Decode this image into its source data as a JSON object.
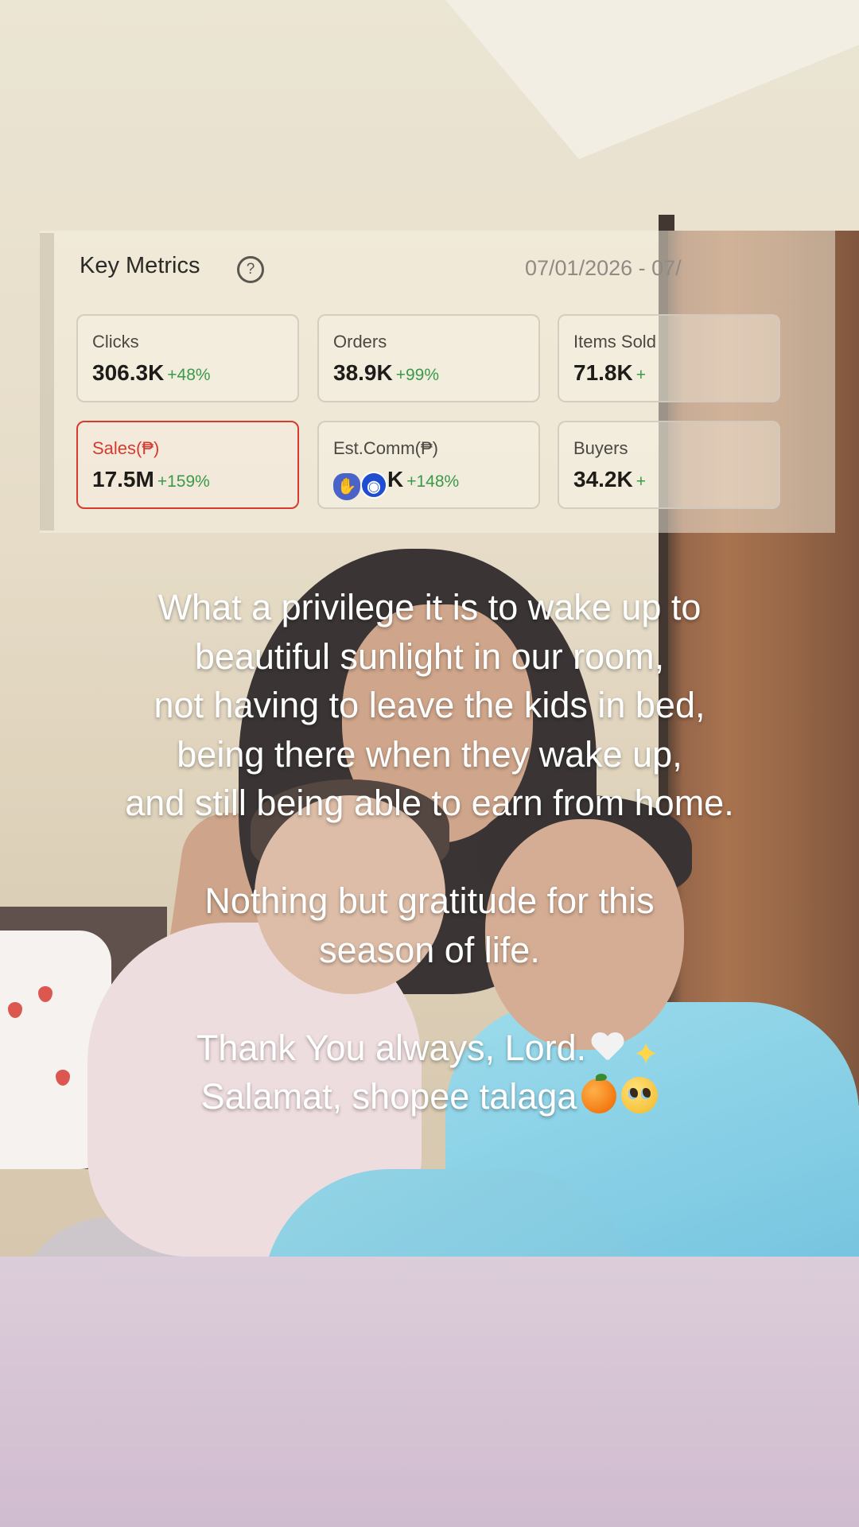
{
  "dashboard": {
    "title": "Key Metrics",
    "help_icon": "question-circle-icon",
    "date_range": "07/01/2026 - 07/",
    "metrics": [
      {
        "label": "Clicks",
        "value": "306.3K",
        "change": "+48%"
      },
      {
        "label": "Orders",
        "value": "38.9K",
        "change": "+99%"
      },
      {
        "label": "Items Sold",
        "value": "71.8K",
        "change": "+"
      },
      {
        "label": "Sales(₱)",
        "value": "17.5M",
        "change": "+159%"
      },
      {
        "label": "Est.Comm(₱)",
        "value": "K",
        "change": "+148%"
      },
      {
        "label": "Buyers",
        "value": "34.2K",
        "change": "+"
      }
    ],
    "colors": {
      "accent": "#d63b2f",
      "positive": "#3a9a4a"
    }
  },
  "caption": {
    "lines": [
      "What a privilege it is to wake up to",
      "beautiful sunlight in our room,",
      "not having to leave the kids in bed,",
      "being there when they wake up,",
      "and still being able to earn from home.",
      "",
      "Nothing but gratitude for this",
      "season of life.",
      "",
      "Thank You always, Lord.",
      "Salamat, shopee talaga"
    ],
    "emoji": [
      "white-heart-icon",
      "sparkles-icon",
      "orange-icon",
      "pleading-face-icon"
    ]
  }
}
